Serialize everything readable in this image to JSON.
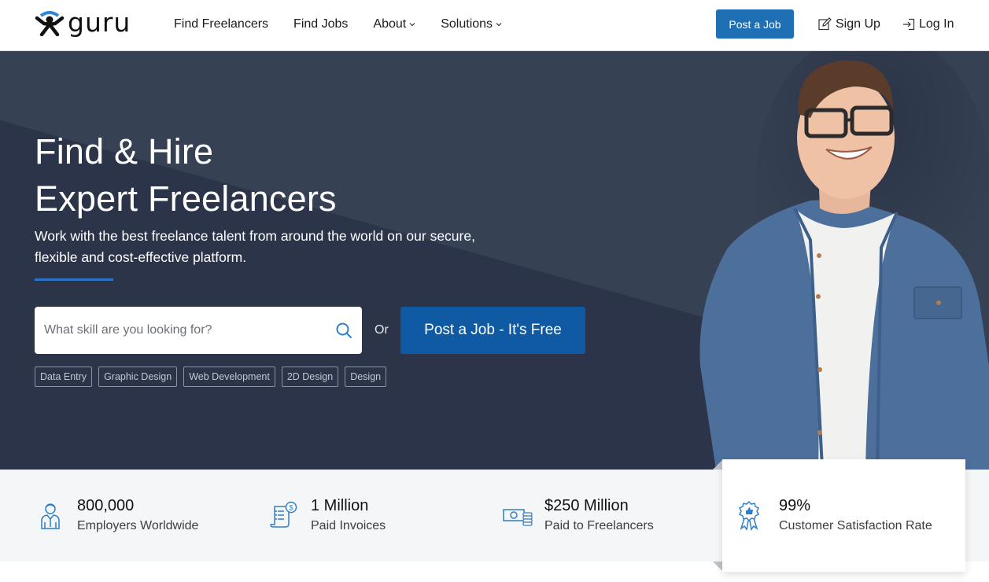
{
  "header": {
    "logo_text": "guru",
    "nav": [
      {
        "label": "Find Freelancers",
        "has_dropdown": false
      },
      {
        "label": "Find Jobs",
        "has_dropdown": false
      },
      {
        "label": "About",
        "has_dropdown": true
      },
      {
        "label": "Solutions",
        "has_dropdown": true
      }
    ],
    "chevron": "⌄",
    "post_job_label": "Post a Job",
    "sign_up_label": "Sign Up",
    "log_in_label": "Log In",
    "brand_color": "#1f6fb5"
  },
  "hero": {
    "title_line1": "Find & Hire",
    "title_line2": "Expert Freelancers",
    "subtitle_line1": "Work with the best freelance talent from around the world on our secure,",
    "subtitle_line2": "flexible and cost-effective platform.",
    "search": {
      "placeholder": "What skill are you looking for?",
      "value": ""
    },
    "or_label": "Or",
    "post_free_label": "Post a Job - It's Free",
    "tags": [
      "Data Entry",
      "Graphic Design",
      "Web Development",
      "2D Design",
      "Design"
    ]
  },
  "stats": [
    {
      "value": "800,000",
      "label": "Employers Worldwide",
      "icon": "employer-icon"
    },
    {
      "value": "1 Million",
      "label": "Paid Invoices",
      "icon": "invoice-icon"
    },
    {
      "value": "$250 Million",
      "label": "Paid to Freelancers",
      "icon": "money-icon"
    },
    {
      "value": "99%",
      "label": "Customer Satisfaction Rate",
      "icon": "award-badge-icon"
    }
  ]
}
